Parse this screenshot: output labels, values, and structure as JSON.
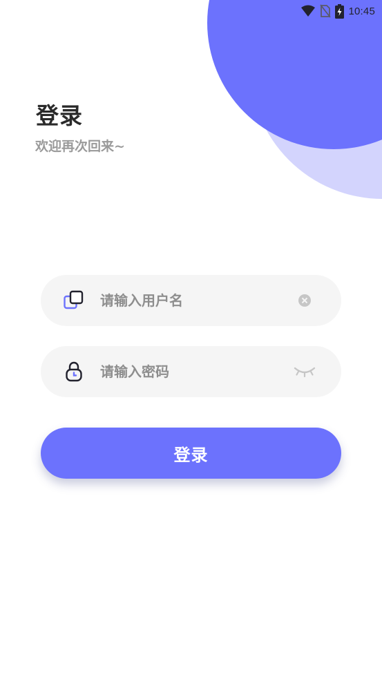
{
  "status_bar": {
    "time": "10:45",
    "icons": [
      "wifi-icon",
      "no-sim-icon",
      "battery-charging-icon"
    ]
  },
  "header": {
    "title": "登录",
    "subtitle": "欢迎再次回来~"
  },
  "form": {
    "username": {
      "value": "",
      "placeholder": "请输入用户名",
      "lead_icon": "user-cards-icon",
      "trail_icon": "clear-icon"
    },
    "password": {
      "value": "",
      "placeholder": "请输入密码",
      "lead_icon": "lock-icon",
      "trail_icon": "eye-closed-icon"
    },
    "submit_label": "登录"
  },
  "colors": {
    "accent": "#6c72fd",
    "accent_light": "#d3d4fd",
    "field_background": "#f5f5f5",
    "title_text": "#2a2a2a",
    "subtitle_text": "#9a9a9a",
    "placeholder_text": "#8e8e8e"
  }
}
